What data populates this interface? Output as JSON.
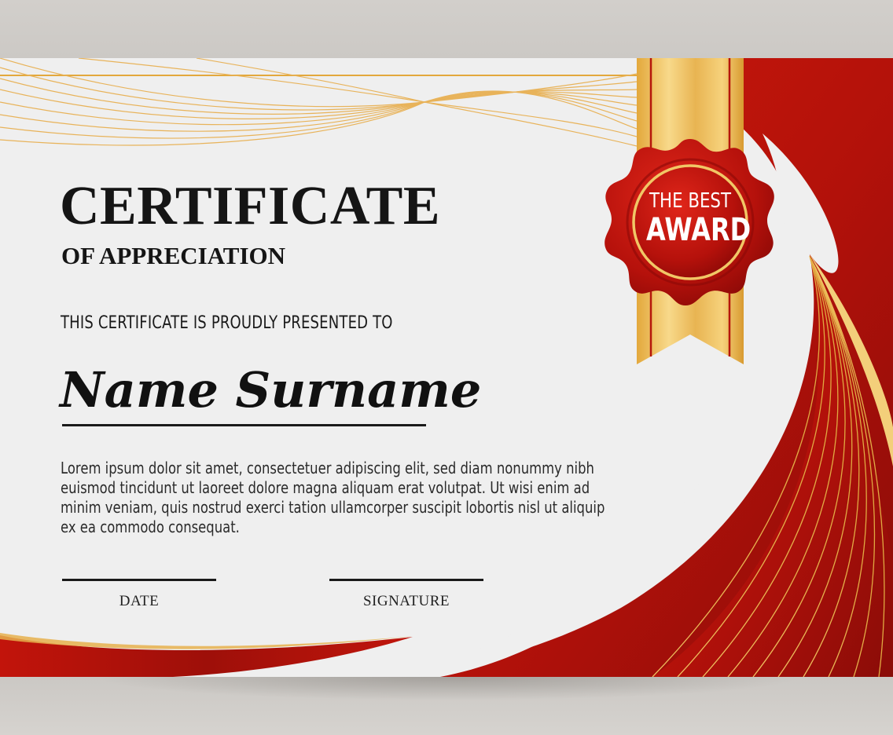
{
  "certificate": {
    "title": "CERTIFICATE",
    "subtitle": "OF APPRECIATION",
    "presented_to": "THIS CERTIFICATE IS PROUDLY PRESENTED TO",
    "recipient": "Name Surname",
    "body": "Lorem ipsum dolor sit amet, consectetuer adipiscing elit, sed diam nonummy nibh euismod tincidunt ut laoreet dolore magna aliquam erat volutpat. Ut wisi enim ad minim veniam, quis nostrud exerci tation ullamcorper suscipit lobortis nisl ut aliquip ex ea commodo consequat.",
    "date_label": "DATE",
    "signature_label": "SIGNATURE"
  },
  "seal": {
    "line1": "THE BEST",
    "line2": "AWARD"
  },
  "colors": {
    "paper": "#efefef",
    "red": "#c0140a",
    "dark_red": "#8a0c08",
    "gold": "#e6b04c",
    "ink": "#151515"
  }
}
